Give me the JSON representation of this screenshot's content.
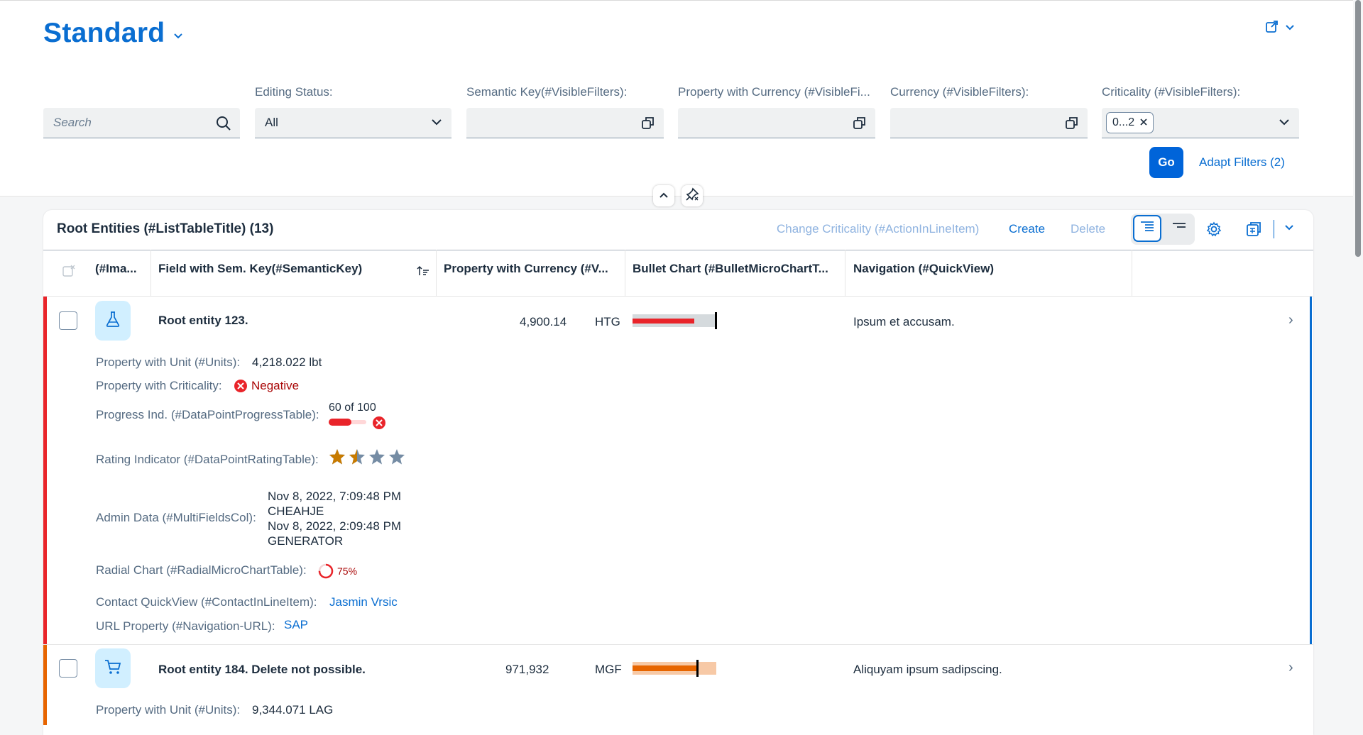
{
  "header": {
    "title": "Standard",
    "filters": [
      {
        "id": "search",
        "label": "",
        "value": "",
        "placeholder": "Search"
      },
      {
        "id": "editing_status",
        "label": "Editing Status:",
        "value": "All"
      },
      {
        "id": "semantic_key",
        "label": "Semantic Key(#VisibleFilters):",
        "value": ""
      },
      {
        "id": "property_currency",
        "label": "Property with Currency (#VisibleFi...",
        "value": ""
      },
      {
        "id": "currency",
        "label": "Currency (#VisibleFilters):",
        "value": ""
      },
      {
        "id": "criticality",
        "label": "Criticality (#VisibleFilters):",
        "token": "0...2"
      }
    ],
    "go_label": "Go",
    "adapt_filters_label": "Adapt Filters (2)"
  },
  "table": {
    "title": "Root Entities (#ListTableTitle) (13)",
    "actions": {
      "change_criticality": "Change Criticality (#ActionInLineItem)",
      "create": "Create",
      "delete": "Delete"
    },
    "columns": [
      "(#Ima...",
      "Field with Sem. Key(#SemanticKey)",
      "Property with Currency (#V...",
      "Bullet Chart (#BulletMicroChartT...",
      "Navigation (#QuickView)"
    ],
    "rows": [
      {
        "icon": "lab-flask-icon",
        "name": "Root entity 123.",
        "amount": "4,900.14",
        "currency": "HTG",
        "bullet": {
          "value_fraction": 0.74,
          "target_fraction": 0.98,
          "color": "#e9242a"
        },
        "navigation": "Ipsum et accusam.",
        "criticality_color": "#e9242a",
        "details": {
          "unit_label": "Property with Unit (#Units):",
          "unit_value": "4,218.022 lbt",
          "criticality_label": "Property with Criticality:",
          "criticality_value": "Negative",
          "progress_label": "Progress Ind. (#DataPointProgressTable):",
          "progress_value": "60 of 100",
          "progress_fraction": 0.6,
          "rating_label": "Rating Indicator (#DataPointRatingTable):",
          "rating_value": 1.5,
          "rating_max": 4,
          "admin_label": "Admin Data (#MultiFieldsCol):",
          "admin_lines": [
            "Nov 8, 2022, 7:09:48 PM",
            "CHEAHJE",
            "Nov 8, 2022, 2:09:48 PM",
            "GENERATOR"
          ],
          "radial_label": "Radial Chart (#RadialMicroChartTable):",
          "radial_value": "75%",
          "radial_fraction": 0.75,
          "contact_label": "Contact QuickView (#ContactInLineItem):",
          "contact_value": "Jasmin Vrsic",
          "url_label": "URL Property (#Navigation-URL):",
          "url_value": "SAP"
        }
      },
      {
        "icon": "shopping-cart-icon",
        "name": "Root entity 184. Delete not possible.",
        "amount": "971,932",
        "currency": "MGF",
        "bullet": {
          "value_fraction": 0.77,
          "target_fraction": 0.76,
          "color": "#e76500"
        },
        "navigation": "Aliquyam ipsum sadipscing.",
        "criticality_color": "#e76500",
        "details": {
          "unit_label": "Property with Unit (#Units):",
          "unit_value": "9,344.071 LAG"
        }
      }
    ]
  },
  "colors": {
    "brand": "#0a6ed1",
    "negative": "#e9242a",
    "critical": "#e76500",
    "rating_filled": "#c87b00",
    "rating_empty": "#758ca4"
  }
}
